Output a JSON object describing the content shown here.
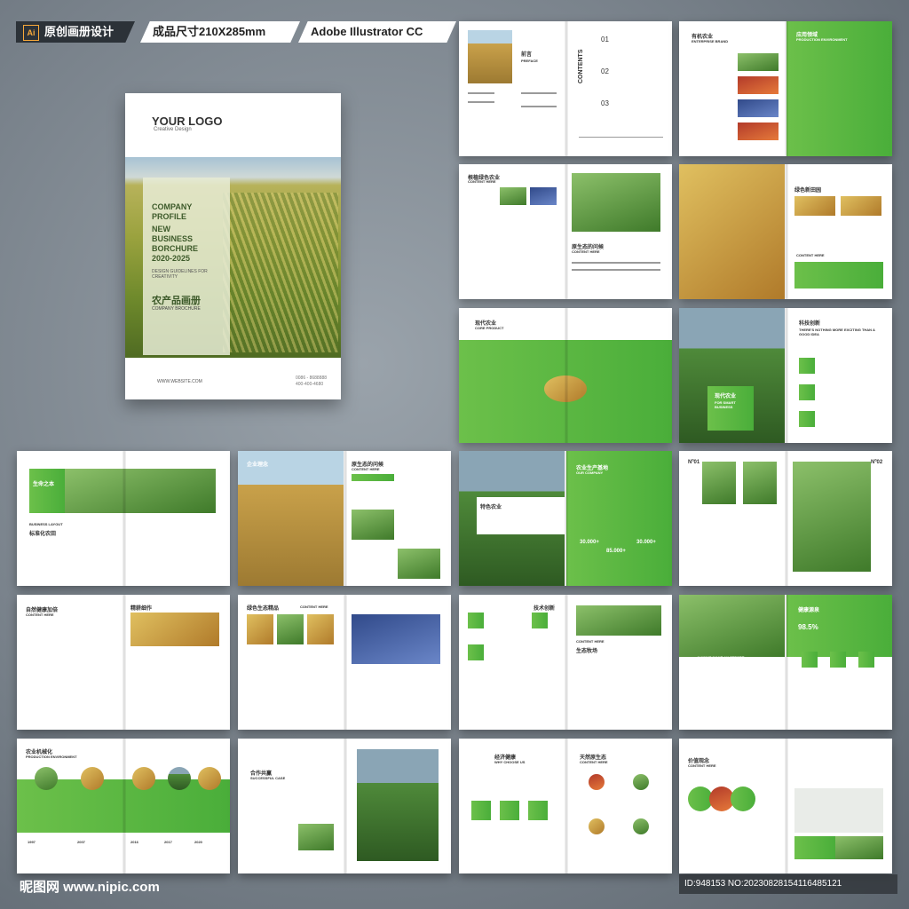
{
  "tags": {
    "ai_icon": "Ai",
    "title": "原创画册设计",
    "size": "成品尺寸210X285mm",
    "software": "Adobe Illustrator CC 2018"
  },
  "cover": {
    "logo": "YOUR LOGO",
    "logo_sub": "Creative Design",
    "line1": "COMPANY",
    "line2": "PROFILE",
    "line3": "NEW",
    "line4": "BUSINESS",
    "line5": "BORCHURE",
    "line6": "2020-2025",
    "small": "DESIGN GUIDELINES FOR CREATIVITY",
    "cn_title": "农产品画册",
    "cn_sub": "COMPANY BROCHURE",
    "website": "WWW.WEBSITE.COM",
    "tel1": "0086 - 8688888",
    "tel2": "400-400-4680"
  },
  "spreads": [
    {
      "a": "前言",
      "b": "PREFACE",
      "c": "CONTENTS",
      "d": "01",
      "e": "02",
      "f": "03"
    },
    {
      "a": "有机农业",
      "b": "ENTERPRISE BRAND",
      "c": "应用领域",
      "d": "PRODUCTION ENVIRONMENT"
    },
    {
      "a": "根植绿色农业",
      "b": "CONTENT HERE",
      "c": "原生态的问候",
      "d": "CONTENT HERE"
    },
    {
      "a": "绿色新田园",
      "b": "CONTENT HERE"
    },
    {
      "a": "现代农业",
      "b": "CORE PRODUCT"
    },
    {
      "a": "科技创新",
      "b": "THERE'S NOTHING MORE EXCITING THAN A GOOD IDEA",
      "c": "现代农业",
      "d": "FOR SMART BUSINESS"
    },
    {
      "a": "生命之本",
      "b": "BUSINESS LAYOUT",
      "c": "标准化农田"
    },
    {
      "a": "企业理念",
      "b": "原生态的问候",
      "c": "CONTENT HERE"
    },
    {
      "a": "特色农业",
      "b": "农业生产基地",
      "c": "OUR COMPANY",
      "d": "30.000+",
      "e": "85.000+",
      "f": "30.000+"
    },
    {
      "a": "Nº01",
      "b": "Nº02"
    },
    {
      "a": "自然健康加倍",
      "b": "CONTENT HERE",
      "c": "精耕细作"
    },
    {
      "a": "绿色生态精品",
      "b": "CONTENT HERE"
    },
    {
      "a": "技术创新",
      "b": "CONTENT HERE",
      "c": "生态牧场"
    },
    {
      "a": "健康源泉",
      "b": "98.5%",
      "c": "ALWAYS MAKE AN EFFORT"
    },
    {
      "a": "农业机械化",
      "b": "PRODUCTION ENVIRONMENT",
      "c": "1997",
      "d": "2007",
      "e": "2016",
      "f": "2017",
      "g": "2020"
    },
    {
      "a": "合作共赢",
      "b": "SUCCESSFUL CASE"
    },
    {
      "a": "经济健康",
      "b": "WHY CHOOSE US",
      "c": "天然原生态",
      "d": "CONTENT HERE"
    },
    {
      "a": "价值观念",
      "b": "CONTENT HERE"
    }
  ],
  "watermark": "昵图网 www.nipic.com",
  "id_text": "ID:948153 NO:20230828154116485121"
}
